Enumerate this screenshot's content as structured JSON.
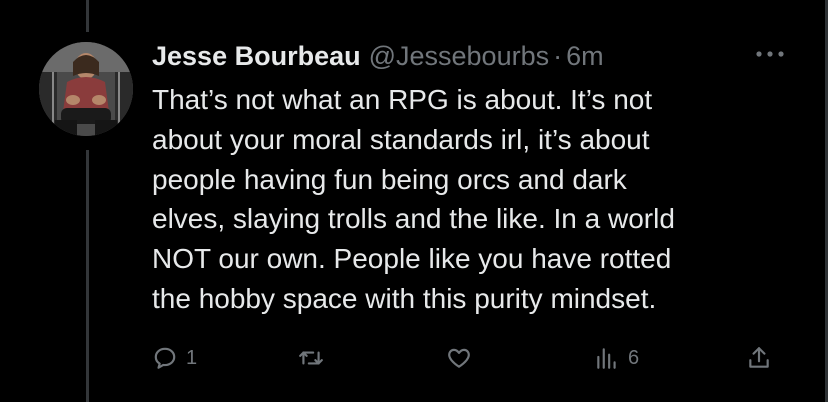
{
  "tweet": {
    "display_name": "Jesse Bourbeau",
    "handle": "@Jessebourbs",
    "separator": "·",
    "time": "6m",
    "text_lines": [
      "That’s not what an RPG is about. It’s not",
      "about your moral standards irl, it’s about",
      "people having fun being orcs and dark",
      "elves, slaying trolls and the like. In a world",
      "NOT our own. People like you have rotted",
      "the hobby space with this purity mindset."
    ],
    "more_icon": "ellipsis-icon",
    "actions": {
      "reply": {
        "icon": "reply-icon",
        "count": "1"
      },
      "retweet": {
        "icon": "retweet-icon",
        "count": ""
      },
      "like": {
        "icon": "heart-icon",
        "count": ""
      },
      "views": {
        "icon": "views-icon",
        "count": "6"
      },
      "share": {
        "icon": "share-icon",
        "count": ""
      }
    }
  },
  "colors": {
    "background": "#000000",
    "text": "#e7e9ea",
    "muted": "#71767b",
    "thread_line": "#333639"
  }
}
